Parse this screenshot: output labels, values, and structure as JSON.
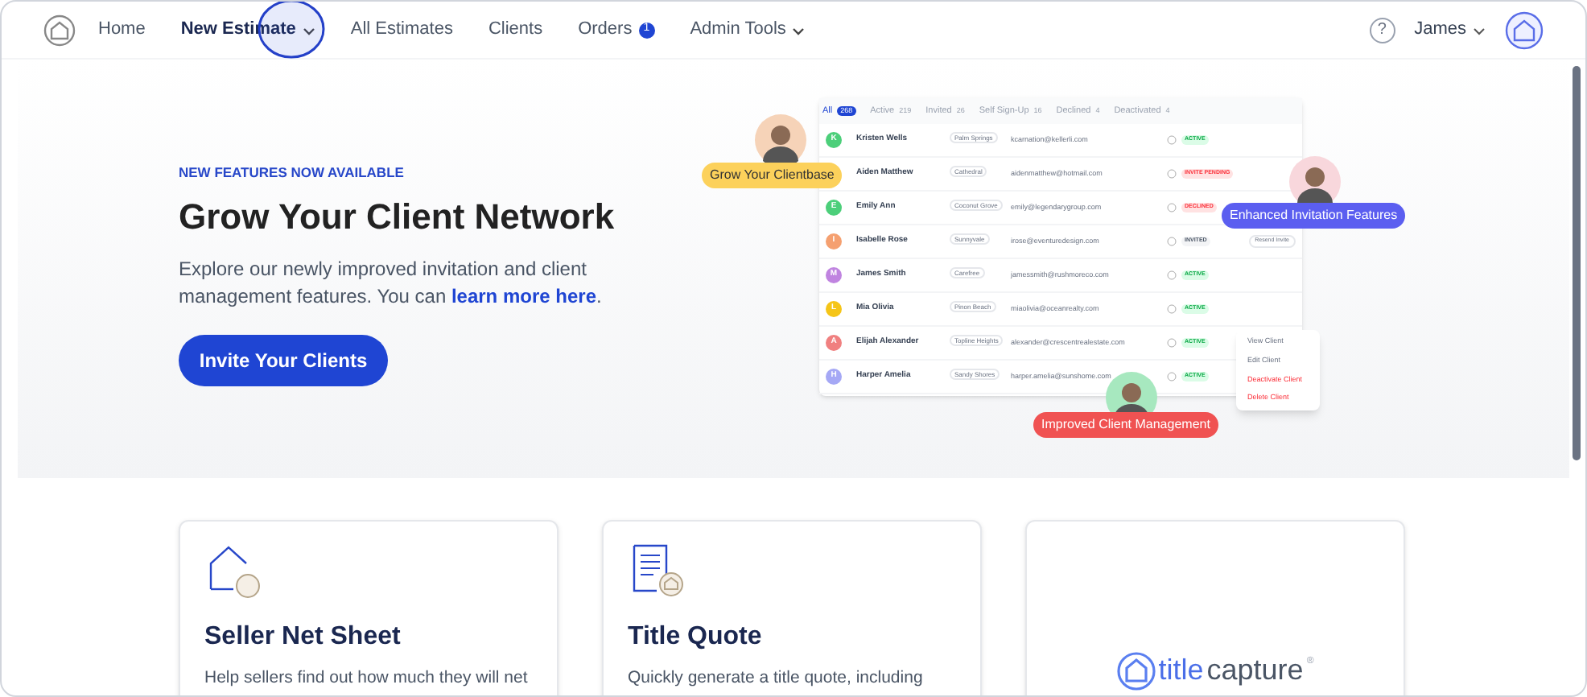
{
  "nav": {
    "items": [
      {
        "label": "Home",
        "selected": false,
        "dropdown": false
      },
      {
        "label": "New Estimate",
        "selected": true,
        "dropdown": true
      },
      {
        "label": "All Estimates",
        "selected": false,
        "dropdown": false
      },
      {
        "label": "Clients",
        "selected": false,
        "dropdown": false
      },
      {
        "label": "Orders",
        "selected": false,
        "dropdown": false,
        "badge": "1"
      },
      {
        "label": "Admin Tools",
        "selected": false,
        "dropdown": true
      }
    ],
    "help": "?",
    "user": "James"
  },
  "hero": {
    "eyebrow": "NEW FEATURES NOW AVAILABLE",
    "title": "Grow Your Client Network",
    "text": "Explore our newly improved invitation and client management features. You can ",
    "link": "learn more here",
    "text_end": ".",
    "button": "Invite Your Clients",
    "mockup": {
      "tabs": [
        {
          "label": "All",
          "count": "268",
          "selected": true
        },
        {
          "label": "Active",
          "count": "219",
          "selected": false
        },
        {
          "label": "Invited",
          "count": "26",
          "selected": false
        },
        {
          "label": "Self Sign-Up",
          "count": "16",
          "selected": false
        },
        {
          "label": "Declined",
          "count": "4",
          "selected": false
        },
        {
          "label": "Deactivated",
          "count": "4",
          "selected": false
        }
      ],
      "rows": [
        {
          "initial": "K",
          "color": "#4ccf7a",
          "name": "Kristen Wells",
          "city": "Palm Springs",
          "email": "kcarnation@kellerli.com",
          "status": "ACTIVE",
          "kind": "active"
        },
        {
          "name": "Aiden Matthew",
          "city": "Cathedral",
          "email": "aidenmatthew@hotmail.com",
          "status": "INVITE PENDING",
          "kind": "declined"
        },
        {
          "initial": "E",
          "color": "#4ccf7a",
          "name": "Emily Ann",
          "city": "Coconut Grove",
          "email": "emily@legendarygroup.com",
          "status": "DECLINED",
          "kind": "declined"
        },
        {
          "initial": "I",
          "color": "#f5a070",
          "name": "Isabelle Rose",
          "city": "Sunnyvale",
          "email": "irose@eventuredesign.com",
          "status": "INVITED",
          "kind": "invited",
          "action": "Resend Invite"
        },
        {
          "initial": "M",
          "color": "#c084e0",
          "name": "James Smith",
          "city": "Carefree",
          "email": "jamessmith@rushmoreco.com",
          "status": "ACTIVE",
          "kind": "active"
        },
        {
          "initial": "L",
          "color": "#f5c518",
          "name": "Mia Olivia",
          "city": "Pinon Beach",
          "email": "miaolivia@oceanrealty.com",
          "status": "ACTIVE",
          "kind": "active"
        },
        {
          "initial": "A",
          "color": "#f08080",
          "name": "Elijah Alexander",
          "city": "Topline Heights",
          "email": "alexander@crescentrealestate.com",
          "status": "ACTIVE",
          "kind": "active"
        },
        {
          "initial": "H",
          "color": "#a5a8f5",
          "name": "Harper Amelia",
          "city": "Sandy Shores",
          "email": "harper.amelia@sunshome.com",
          "status": "ACTIVE",
          "kind": "active"
        }
      ],
      "menu": [
        {
          "label": "View Client",
          "kind": "normal"
        },
        {
          "label": "Edit Client",
          "kind": "normal"
        },
        {
          "label": "Deactivate Client",
          "kind": "danger"
        },
        {
          "label": "Delete Client",
          "kind": "danger"
        }
      ],
      "callouts": [
        {
          "label": "Grow Your Clientbase",
          "color": "#fcd15b"
        },
        {
          "label": "Enhanced Invitation Features",
          "color": "#5b5ef0"
        },
        {
          "label": "Improved Client Management",
          "color": "#f05252"
        }
      ]
    }
  },
  "cards": [
    {
      "kind": "seller",
      "title": "Seller Net Sheet",
      "text": "Help sellers find out how much they will net"
    },
    {
      "kind": "quote",
      "title": "Title Quote",
      "text": "Quickly generate a title quote, including"
    },
    {
      "kind": "logo",
      "logo_a": "title",
      "logo_b": "capture",
      "mark": "®"
    }
  ]
}
